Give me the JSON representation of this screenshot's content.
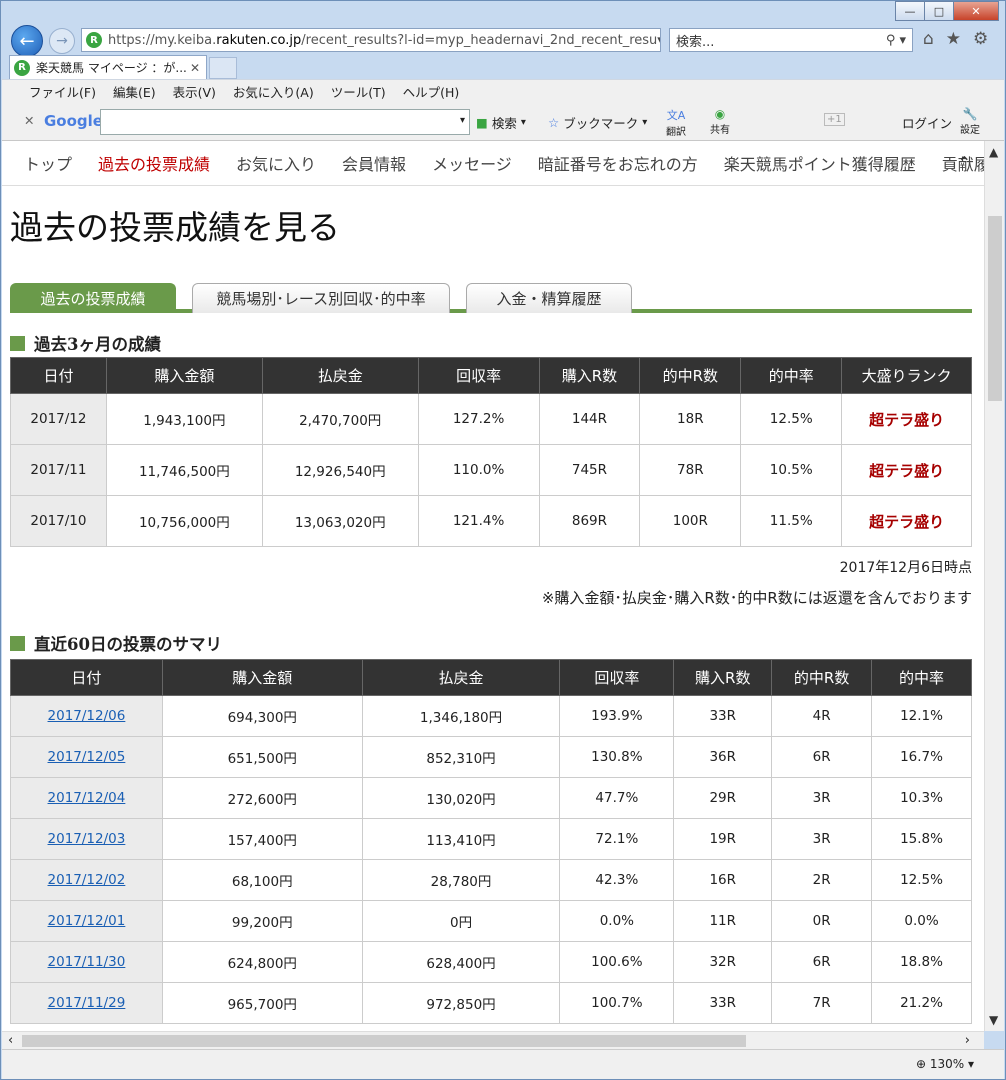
{
  "browser": {
    "url_prefix": "https://my.keiba.",
    "url_host": "rakuten.co.jp",
    "url_suffix": "/recent_results?l-id=myp_headernavi_2nd_recent_resu",
    "search_placeholder": "検索...",
    "tab_title": "楽天競馬 マイページ ：が...",
    "menu": [
      "ファイル(F)",
      "編集(E)",
      "表示(V)",
      "お気に入り(A)",
      "ツール(T)",
      "ヘルプ(H)"
    ],
    "google_toolbar": {
      "logo": "Google",
      "search_label": "検索",
      "bookmark_label": "ブックマーク",
      "translate_label": "翻訳",
      "share_label": "共有",
      "plus_one": "+1",
      "login_label": "ログイン",
      "settings_label": "設定"
    },
    "zoom": "130%"
  },
  "page": {
    "topnav": [
      "トップ",
      "過去の投票成績",
      "お気に入り",
      "会員情報",
      "メッセージ",
      "暗証番号をお忘れの方",
      "楽天競馬ポイント獲得履歴",
      "貢献履歴"
    ],
    "title": "過去の投票成績を見る",
    "tabs": [
      "過去の投票成績",
      "競馬場別･レース別回収･的中率",
      "入金・精算履歴"
    ],
    "section1": {
      "title": "過去3ヶ月の成績",
      "headers": [
        "日付",
        "購入金額",
        "払戻金",
        "回収率",
        "購入R数",
        "的中R数",
        "的中率",
        "大盛りランク"
      ],
      "rows": [
        [
          "2017/12",
          "1,943,100円",
          "2,470,700円",
          "127.2%",
          "144R",
          "18R",
          "12.5%",
          "超テラ盛り"
        ],
        [
          "2017/11",
          "11,746,500円",
          "12,926,540円",
          "110.0%",
          "745R",
          "78R",
          "10.5%",
          "超テラ盛り"
        ],
        [
          "2017/10",
          "10,756,000円",
          "13,063,020円",
          "121.4%",
          "869R",
          "100R",
          "11.5%",
          "超テラ盛り"
        ]
      ],
      "note_time": "2017年12月6日時点",
      "note_refund": "※購入金額･払戻金･購入R数･的中R数には返還を含んでおります"
    },
    "section2": {
      "title": "直近60日の投票のサマリ",
      "headers": [
        "日付",
        "購入金額",
        "払戻金",
        "回収率",
        "購入R数",
        "的中R数",
        "的中率"
      ],
      "rows": [
        [
          "2017/12/06",
          "694,300円",
          "1,346,180円",
          "193.9%",
          "33R",
          "4R",
          "12.1%"
        ],
        [
          "2017/12/05",
          "651,500円",
          "852,310円",
          "130.8%",
          "36R",
          "6R",
          "16.7%"
        ],
        [
          "2017/12/04",
          "272,600円",
          "130,020円",
          "47.7%",
          "29R",
          "3R",
          "10.3%"
        ],
        [
          "2017/12/03",
          "157,400円",
          "113,410円",
          "72.1%",
          "19R",
          "3R",
          "15.8%"
        ],
        [
          "2017/12/02",
          "68,100円",
          "28,780円",
          "42.3%",
          "16R",
          "2R",
          "12.5%"
        ],
        [
          "2017/12/01",
          "99,200円",
          "0円",
          "0.0%",
          "11R",
          "0R",
          "0.0%"
        ],
        [
          "2017/11/30",
          "624,800円",
          "628,400円",
          "100.6%",
          "32R",
          "6R",
          "18.8%"
        ],
        [
          "2017/11/29",
          "965,700円",
          "972,850円",
          "100.7%",
          "33R",
          "7R",
          "21.2%"
        ]
      ]
    }
  },
  "colors": {
    "accent_green": "#6a9a4a",
    "active_red": "#bf0000",
    "rank_red": "#a60000",
    "header_dark": "#333333",
    "link_blue": "#1a5fb4"
  }
}
